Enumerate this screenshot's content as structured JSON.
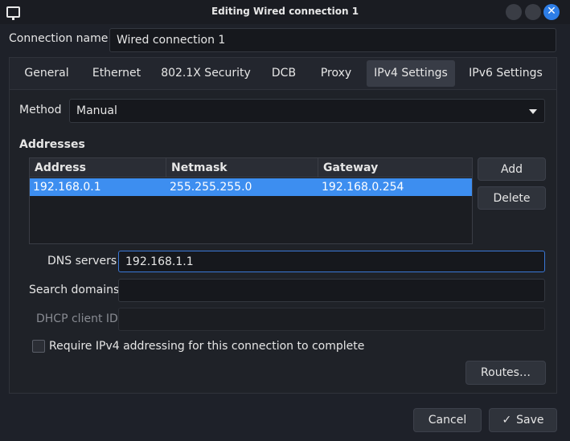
{
  "window": {
    "title": "Editing Wired connection 1",
    "close_glyph": "✕"
  },
  "connection_name": {
    "label": "Connection name",
    "value": "Wired connection 1"
  },
  "tabs": [
    {
      "label": "General"
    },
    {
      "label": "Ethernet"
    },
    {
      "label": "802.1X Security"
    },
    {
      "label": "DCB"
    },
    {
      "label": "Proxy"
    },
    {
      "label": "IPv4 Settings",
      "active": true
    },
    {
      "label": "IPv6 Settings"
    }
  ],
  "ipv4": {
    "method_label": "Method",
    "method_value": "Manual",
    "addresses_heading": "Addresses",
    "columns": [
      "Address",
      "Netmask",
      "Gateway"
    ],
    "rows": [
      [
        "192.168.0.1",
        "255.255.255.0",
        "192.168.0.254"
      ]
    ],
    "add_label": "Add",
    "delete_label": "Delete",
    "dns_label": "DNS servers",
    "dns_value": "192.168.1.1",
    "search_label": "Search domains",
    "search_value": "",
    "dhcp_label": "DHCP client ID",
    "dhcp_value": "",
    "require_label": "Require IPv4 addressing for this connection to complete",
    "require_checked": false,
    "routes_label": "Routes…"
  },
  "footer": {
    "cancel_label": "Cancel",
    "save_label": "Save",
    "save_icon": "✓"
  },
  "colors": {
    "accent": "#3d8ef0",
    "background": "#1e2129",
    "close_button": "#2d7de6"
  },
  "icons": {
    "app": "monitor-icon",
    "close": "close-icon",
    "dropdown": "chevron-down-icon",
    "save": "checkmark-icon"
  }
}
